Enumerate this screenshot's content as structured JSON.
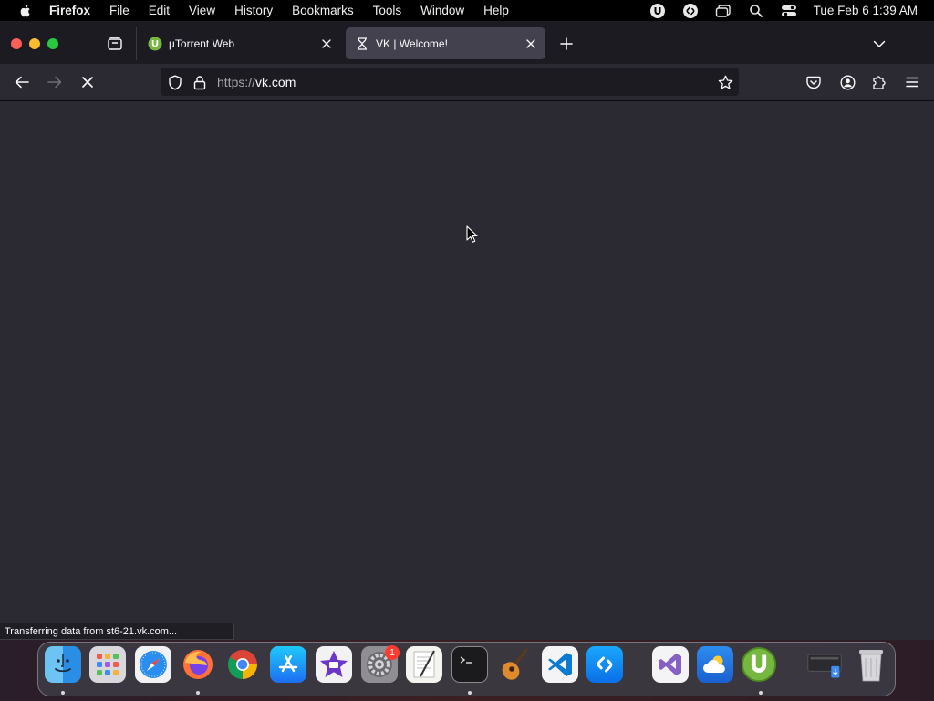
{
  "menubar": {
    "app_name": "Firefox",
    "items": [
      "File",
      "Edit",
      "View",
      "History",
      "Bookmarks",
      "Tools",
      "Window",
      "Help"
    ],
    "clock": "Tue Feb 6  1:39 AM",
    "status_icons": [
      "utorrent-status-icon",
      "shazam-status-icon",
      "window-switcher-icon",
      "spotlight-search-icon",
      "control-center-icon"
    ]
  },
  "tabs": [
    {
      "title": "µTorrent Web",
      "icon": "utorrent-icon",
      "active": false
    },
    {
      "title": "VK | Welcome!",
      "icon": "loading-hourglass-icon",
      "active": true
    }
  ],
  "urlbar": {
    "scheme": "https://",
    "host": "vk.com"
  },
  "status_panel": {
    "text": "Transferring data from st6-21.vk.com..."
  },
  "dock": {
    "apps": [
      "Finder",
      "Launchpad",
      "Safari",
      "Firefox",
      "Google Chrome",
      "App Store",
      "iMovie",
      "System Preferences",
      "TextEdit",
      "Terminal",
      "GarageBand",
      "Visual Studio Code",
      "Shazam",
      "Visual Studio",
      "iCloud Weather",
      "uTorrent Web",
      "Downloads Stack",
      "Trash"
    ],
    "system_preferences_badge": "1"
  },
  "colors": {
    "content_bg": "#2b2a33",
    "tabstrip_bg": "#1c1b22",
    "active_tab": "#42414d",
    "accent_utorrent": "#76b83f"
  }
}
